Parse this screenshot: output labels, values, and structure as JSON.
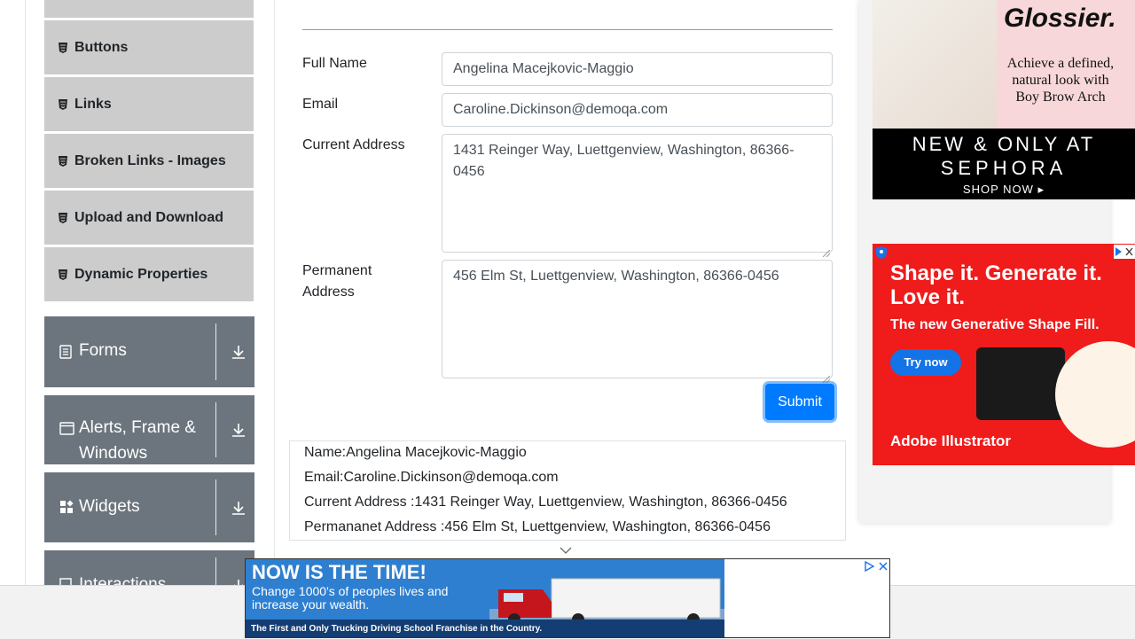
{
  "sidebar": {
    "elements_items": [
      {
        "label": "Buttons"
      },
      {
        "label": "Links"
      },
      {
        "label": "Broken Links - Images"
      },
      {
        "label": "Upload and Download"
      },
      {
        "label": "Dynamic Properties"
      }
    ],
    "groups": [
      {
        "label": "Forms",
        "icon": "form-icon"
      },
      {
        "label": "Alerts, Frame & Windows",
        "icon": "window-icon"
      },
      {
        "label": "Widgets",
        "icon": "widgets-icon"
      },
      {
        "label": "Interactions",
        "icon": "interactions-icon"
      }
    ]
  },
  "form": {
    "full_name_label": "Full Name",
    "full_name_value": "Angelina Macejkovic-Maggio",
    "email_label": "Email",
    "email_value": "Caroline.Dickinson@demoqa.com",
    "current_address_label": "Current Address",
    "current_address_value": "1431 Reinger Way, Luettgenview, Washington, 86366-0456",
    "permanent_address_label_1": "Permanent",
    "permanent_address_label_2": "Address",
    "permanent_address_value": "456 Elm St, Luettgenview, Washington, 86366-0456",
    "submit_label": "Submit"
  },
  "output": {
    "name": "Name:Angelina Macejkovic-Maggio",
    "email": "Email:Caroline.Dickinson@demoqa.com",
    "current_address": "Current Address :1431 Reinger Way, Luettgenview, Washington, 86366-0456",
    "permanent_address": "Permananet Address :456 Elm St, Luettgenview, Washington, 86366-0456"
  },
  "ads": {
    "glossier": {
      "brand": "Glossier.",
      "tagline": "Achieve a defined, natural look with Boy Brow Arch",
      "line1": "NEW & ONLY AT",
      "line2": "SEPHORA",
      "cta": "SHOP NOW ▸"
    },
    "adobe": {
      "headline": "Shape it. Generate it. Love it.",
      "subhead": "The new Generative Shape Fill.",
      "cta": "Try now",
      "logo": "Adobe Illustrator"
    },
    "trucking": {
      "headline": "NOW IS THE TIME!",
      "body": "Change 1000's of peoples lives and increase your wealth.",
      "footer": "The First and Only Trucking Driving School Franchise in the Country."
    }
  },
  "colors": {
    "submit": "#007bff",
    "group_bg": "#6c757d",
    "item_bg": "#cccccc"
  }
}
